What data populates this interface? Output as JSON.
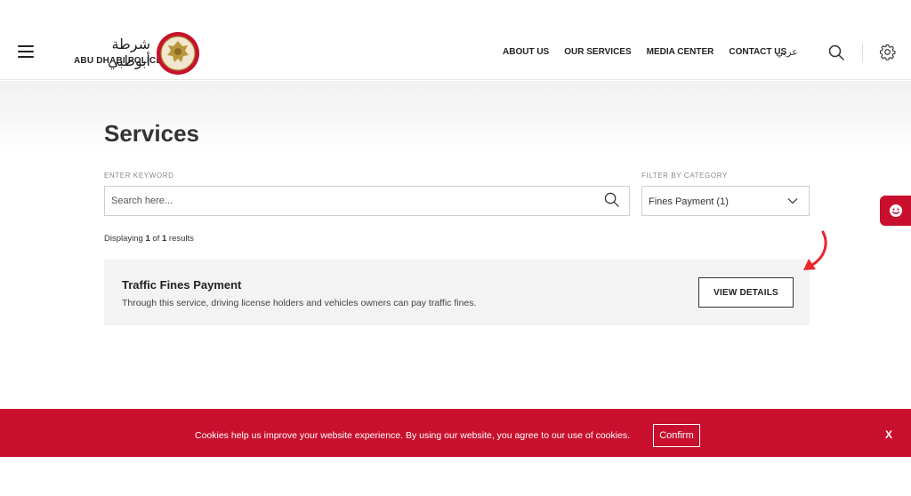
{
  "header": {
    "logo_arabic": "شرطة أبوظبي",
    "logo_english": "ABU DHABI POLICE",
    "nav": [
      {
        "label": "ABOUT US"
      },
      {
        "label": "OUR SERVICES"
      },
      {
        "label": "MEDIA CENTER"
      },
      {
        "label": "CONTACT US"
      }
    ],
    "language": "عربي",
    "icons": {
      "menu": "hamburger-icon",
      "search": "search-icon",
      "settings": "gear-icon",
      "emblem": "police-emblem"
    }
  },
  "page": {
    "title": "Services"
  },
  "filters": {
    "keyword_label": "ENTER KEYWORD",
    "keyword_placeholder": "Search here...",
    "category_label": "FILTER BY CATEGORY",
    "category_value": "Fines Payment (1)"
  },
  "results": {
    "prefix": "Displaying",
    "shown": "1",
    "of_word": "of",
    "total": "1",
    "suffix": "results"
  },
  "services": [
    {
      "title": "Traffic Fines Payment",
      "description": "Through this service, driving license holders and vehicles owners can pay traffic fines.",
      "button_label": "VIEW DETAILS"
    }
  ],
  "cookie_banner": {
    "message": "Cookies help us improve your website experience. By using our website, you agree to our use of cookies.",
    "confirm_label": "Confirm",
    "close_label": "X"
  },
  "colors": {
    "brand_red": "#c8102e",
    "card_bg": "#f3f3f4",
    "text_dark": "#222222"
  }
}
